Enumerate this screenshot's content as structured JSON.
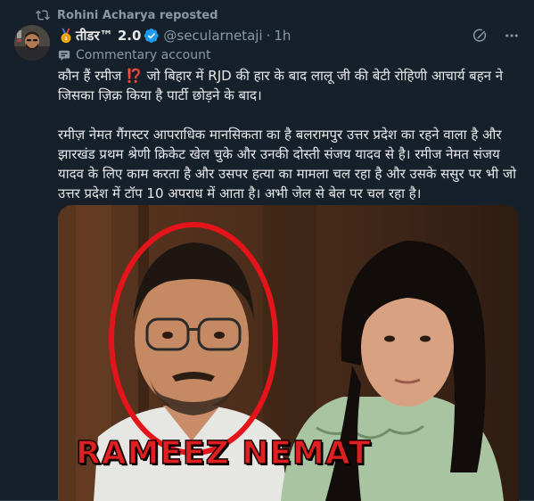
{
  "repost": {
    "label": "Rohini Acharya reposted",
    "icon": "repost-icon"
  },
  "author": {
    "name_prefix": "🥇",
    "display_name": "तीडर™ 2.0",
    "verified": true,
    "handle": "@secularnetaji",
    "separator": "·",
    "time": "1h"
  },
  "label": {
    "text": "Commentary account",
    "icon": "commentary-badge-icon"
  },
  "post": {
    "paragraph1": "कौन हैं रमीज ⁉️ जो बिहार में RJD की हार के बाद लालू जी की बेटी रोहिणी आचार्य बहन ने जिसका ज़िक्र किया है पार्टी छोड़ने के बाद।",
    "paragraph2": "रमीज़ नेमत गैंगस्टर आपराधिक मानसिकता का है बलरामपुर उत्तर प्रदेश का रहने वाला है और झारखंड प्रथम श्रेणी क्रिकेट खेल चुके और उनकी दोस्ती संजय यादव से है। रमीज नेमत संजय यादव के लिए काम करता है और उसपर हत्या का मामला चल रहा है और उसके ससुर पर भी जो उत्तर प्रदेश में टॉप 10 अपराध में आता है। अभी जेल से बेल पर चल रहा है।"
  },
  "media": {
    "caption": "RAMEEZ NEMAT"
  },
  "colors": {
    "background": "#15202b",
    "text": "#e7e9ea",
    "muted": "#8b98a5",
    "verified": "#1d9bf0",
    "caption_red": "#e02020"
  }
}
